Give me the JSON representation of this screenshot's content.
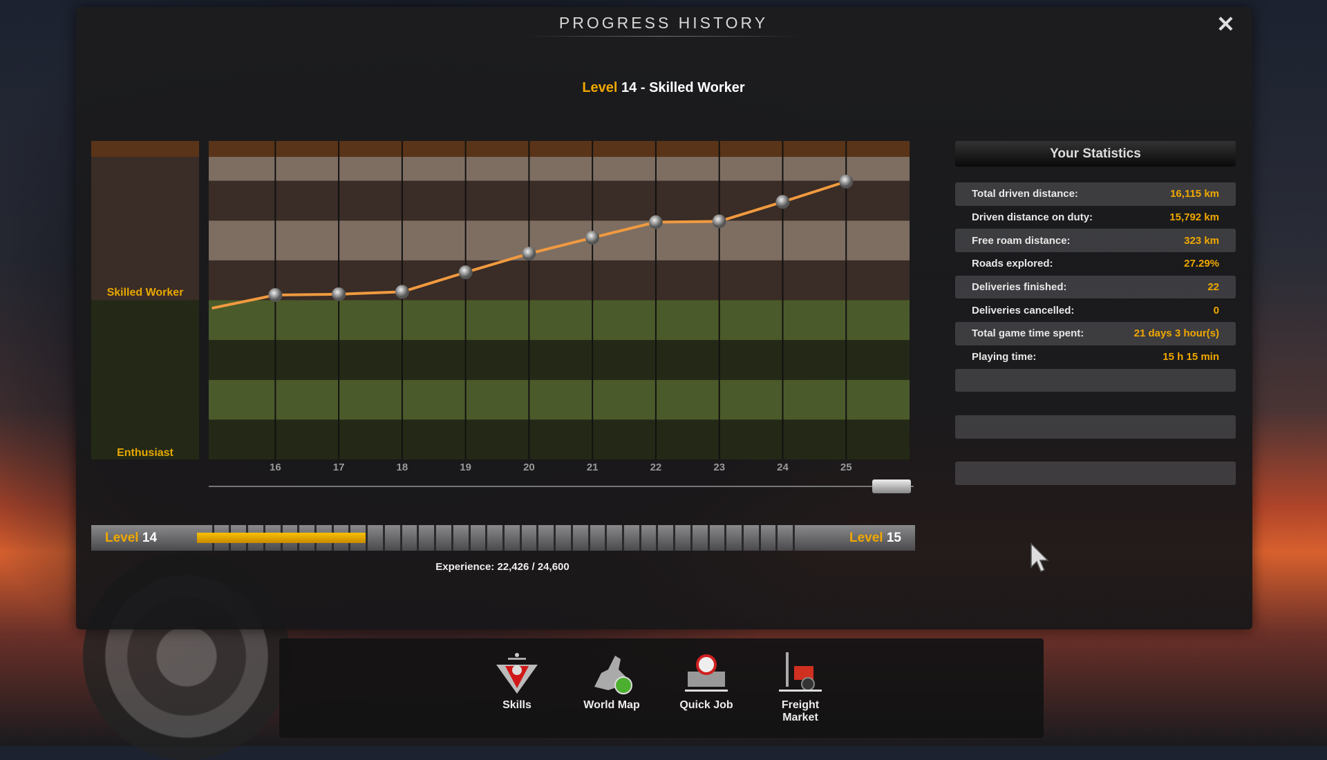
{
  "window": {
    "title": "PROGRESS HISTORY",
    "close_icon": "close-icon"
  },
  "header": {
    "level_word": "Level",
    "level_rest": " 14 - Skilled Worker"
  },
  "chart_data": {
    "type": "line",
    "x": [
      15,
      16,
      17,
      18,
      19,
      20,
      21,
      22,
      23,
      24,
      25
    ],
    "y": [
      3.8,
      4.13,
      4.15,
      4.21,
      4.7,
      5.17,
      5.57,
      5.96,
      5.98,
      6.47,
      6.98
    ],
    "xtick_labels": [
      "16",
      "17",
      "18",
      "19",
      "20",
      "21",
      "22",
      "23",
      "24",
      "25"
    ],
    "ylim": [
      0,
      8
    ],
    "xlim": [
      14.95,
      26
    ],
    "y_rank_labels": [
      "Skilled Worker",
      "Enthusiast"
    ],
    "grid": true,
    "line_color": "#f09a40",
    "band_colors": {
      "skilled_light": "#7e6e62",
      "skilled_dark": "#3a2c26",
      "enthusiast_light": "#4b5a2a",
      "enthusiast_dark": "#232916",
      "top": "#5a3418"
    }
  },
  "level_bar": {
    "left_word": "Level",
    "left_num": "14",
    "right_word": "Level",
    "right_num": "15",
    "progress": 0.275,
    "segments": 36
  },
  "experience": "Experience: 22,426 / 24,600",
  "stats": {
    "title": "Your Statistics",
    "rows": [
      {
        "label": "Total driven distance:",
        "value": "16,115 km"
      },
      {
        "label": "Driven distance on duty:",
        "value": "15,792 km"
      },
      {
        "label": "Free roam distance:",
        "value": "323 km"
      },
      {
        "label": "Roads explored:",
        "value": "27.29%"
      },
      {
        "label": "Deliveries finished:",
        "value": "22"
      },
      {
        "label": "Deliveries cancelled:",
        "value": "0"
      },
      {
        "label": "Total game time spent:",
        "value": "21 days 3 hour(s)"
      },
      {
        "label": "Playing time:",
        "value": "15 h 15 min"
      },
      {
        "label": "",
        "value": ""
      },
      {
        "label": "",
        "value": ""
      },
      {
        "label": "",
        "value": ""
      },
      {
        "label": "",
        "value": ""
      },
      {
        "label": "",
        "value": ""
      }
    ]
  },
  "dock": [
    {
      "label": "Skills",
      "icon": "skills-icon"
    },
    {
      "label": "World Map",
      "icon": "world-map-icon"
    },
    {
      "label": "Quick Job",
      "icon": "quick-job-icon"
    },
    {
      "label": "Freight Market",
      "icon": "freight-market-icon"
    }
  ]
}
